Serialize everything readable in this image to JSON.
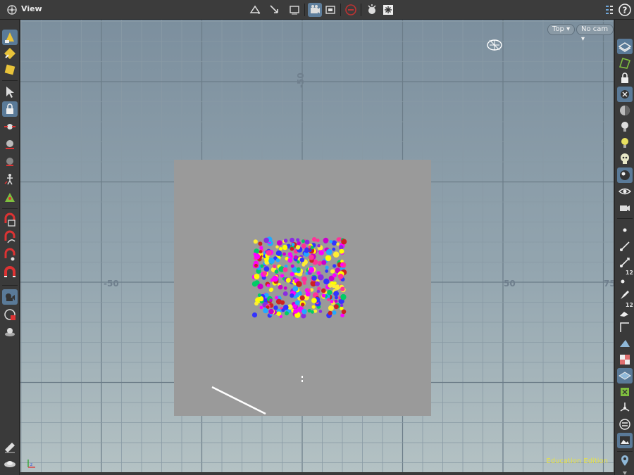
{
  "window": {
    "title": "View"
  },
  "viewport": {
    "view_menu": "Top",
    "camera_menu": "No cam",
    "edition_label": "Education Edition",
    "axis_labels": {
      "x_neg": "-50",
      "x_pos": "50",
      "x_far": "75",
      "y_neg": "-50"
    }
  },
  "right_toolbar": {
    "point_number_badge": "12",
    "prim_number_badge": "12"
  },
  "colors": {
    "particle_palette": [
      "#ff00ff",
      "#ffff00",
      "#3333ff",
      "#ff3399",
      "#cc00cc",
      "#cc2222",
      "#00cc66",
      "#ffee33",
      "#8a2be2",
      "#22aaff"
    ],
    "plane": "#9a9a9a",
    "accent": "#5a7a98",
    "edition_text": "#e5e14a"
  },
  "icons": {
    "top_toolbar": [
      "display-options-icon",
      "snap-icon",
      "handle-icon",
      "camera-icon",
      "viewport-layout-icon",
      "no-entry-icon",
      "render-icon",
      "snowflake-icon",
      "layout-icon",
      "help-icon"
    ],
    "left_toolbar": [
      "pose-tool-icon",
      "paint-icon",
      "sculpt-icon",
      "select-arrow-icon",
      "lock-icon",
      "transform-icon",
      "view-icon",
      "brush-icon",
      "figure-icon",
      "handles-icon",
      "snap-grid-icon",
      "snap-curve-icon",
      "snap-point-icon",
      "magnet-icon",
      "camera-move-icon",
      "grid-plane-icon",
      "construction-icon",
      "stamp-icon",
      "saucer-icon"
    ],
    "right_toolbar": [
      "display-icon",
      "ghost-icon",
      "lock-icon",
      "close-x-icon",
      "shading-icon",
      "light-bulb-icon",
      "light-bulb-alt-icon",
      "skull-icon",
      "sphere-icon",
      "eye-icon",
      "eye-camera-icon",
      "point-icon",
      "line-icon",
      "normal-icon",
      "point-number-icon",
      "prim-number-icon",
      "axis-icon",
      "backface-icon",
      "checker-icon",
      "floor-icon",
      "uv-icon",
      "origin-icon",
      "list-icon",
      "background-image-icon",
      "location-pin-icon"
    ]
  }
}
